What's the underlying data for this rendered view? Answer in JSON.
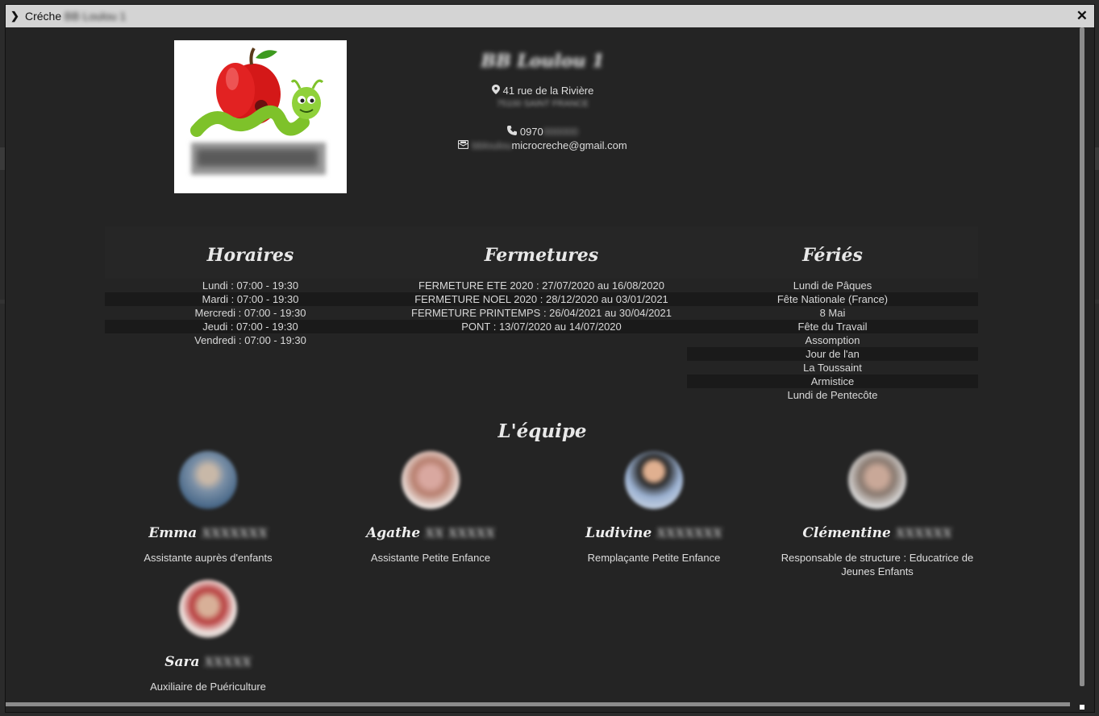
{
  "window": {
    "title": "Créche",
    "title_blurred": "BB Loulou 1",
    "close_symbol": "✕"
  },
  "creche": {
    "name": "BB Loulou 1",
    "address": "41 rue de la Rivière",
    "city": "75100 SAINT FRANCE",
    "phone_prefix": "0970",
    "phone_blurred": "000000",
    "email_blurred": "bbloulou",
    "email": "microcreche@gmail.com"
  },
  "schedule": {
    "horaires_title": "Horaires",
    "horaires": [
      "Lundi : 07:00 - 19:30",
      "Mardi : 07:00 - 19:30",
      "Mercredi : 07:00 - 19:30",
      "Jeudi : 07:00 - 19:30",
      "Vendredi : 07:00 - 19:30"
    ],
    "fermetures_title": "Fermetures",
    "fermetures": [
      "FERMETURE ETE 2020 : 27/07/2020 au 16/08/2020",
      "FERMETURE NOEL 2020 : 28/12/2020 au 03/01/2021",
      "FERMETURE PRINTEMPS : 26/04/2021 au 30/04/2021",
      "PONT : 13/07/2020 au 14/07/2020"
    ],
    "feries_title": "Fériés",
    "feries": [
      "Lundi de Pâques",
      "Fête Nationale (France)",
      "8 Mai",
      "Fête du Travail",
      "Assomption",
      "Jour de l'an",
      "La Toussaint",
      "Armistice",
      "Lundi de Pentecôte"
    ]
  },
  "team": {
    "title": "L'équipe",
    "members": [
      {
        "first": "Emma",
        "last": "XXXXXXX",
        "role": "Assistante auprès d'enfants"
      },
      {
        "first": "Agathe",
        "last": "XX XXXXX",
        "role": "Assistante Petite Enfance"
      },
      {
        "first": "Ludivine",
        "last": "XXXXXXX",
        "role": "Remplaçante Petite Enfance"
      },
      {
        "first": "Clémentine",
        "last": "XXXXXX",
        "role": "Responsable de structure : Educatrice de Jeunes Enfants"
      },
      {
        "first": "Sara",
        "last": "XXXXX",
        "role": "Auxiliaire de Puériculture"
      }
    ]
  },
  "icons": {
    "expand": "chevron-right-icon",
    "close": "close-icon",
    "address": "map-marker-icon",
    "phone": "phone-icon",
    "email": "envelope-icon"
  }
}
